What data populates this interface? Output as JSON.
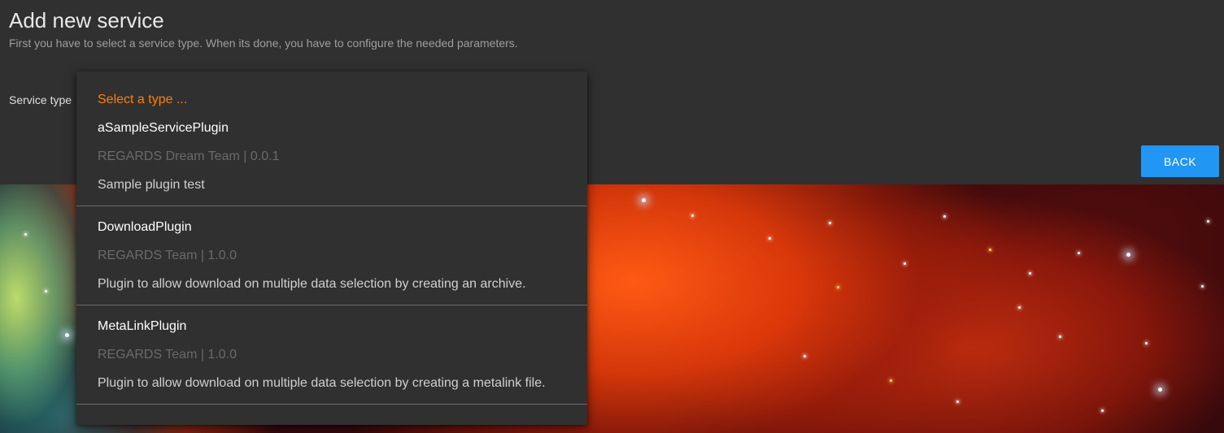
{
  "header": {
    "title": "Add new service",
    "subtitle": "First you have to select a service type. When its done, you have to configure the needed parameters."
  },
  "form": {
    "service_type_label": "Service type"
  },
  "dropdown": {
    "placeholder": "Select a type ...",
    "options": [
      {
        "name": "aSampleServicePlugin",
        "meta": "REGARDS Dream Team | 0.0.1",
        "description": "Sample plugin test"
      },
      {
        "name": "DownloadPlugin",
        "meta": "REGARDS Team | 1.0.0",
        "description": "Plugin to allow download on multiple data selection by creating an archive."
      },
      {
        "name": "MetaLinkPlugin",
        "meta": "REGARDS Team | 1.0.0",
        "description": "Plugin to allow download on multiple data selection by creating a metalink file."
      }
    ]
  },
  "actions": {
    "back_label": "BACK"
  },
  "colors": {
    "accent": "#ff7f0e",
    "primary_button": "#2196f3",
    "background": "#303030"
  }
}
